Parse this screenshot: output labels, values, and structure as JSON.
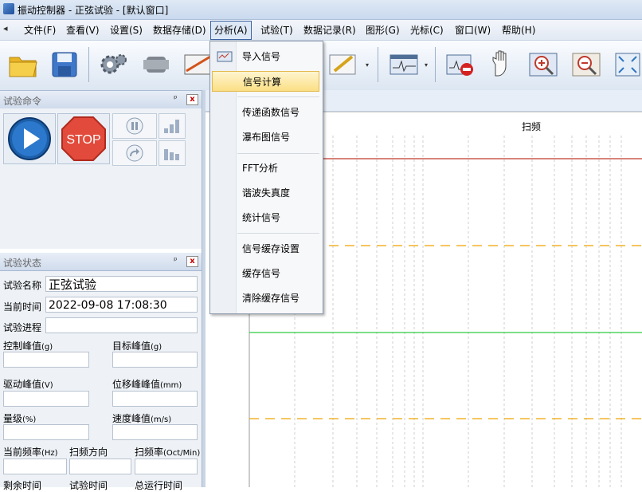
{
  "window": {
    "title": "振动控制器 - 正弦试验 - [默认窗口]"
  },
  "menubar": {
    "items": [
      {
        "label": "文件(F)"
      },
      {
        "label": "查看(V)"
      },
      {
        "label": "设置(S)"
      },
      {
        "label": "数据存储(D)"
      },
      {
        "label": "分析(A)"
      },
      {
        "label": "试验(T)"
      },
      {
        "label": "数据记录(R)"
      },
      {
        "label": "图形(G)"
      },
      {
        "label": "光标(C)"
      },
      {
        "label": "窗口(W)"
      },
      {
        "label": "帮助(H)"
      }
    ],
    "active_index": 4
  },
  "toolbar": {
    "buttons": [
      "open-folder-icon",
      "save-disk-icon",
      "gear-icon",
      "cylinder-icon",
      "chart-edit-icon",
      "pencil-chart-icon",
      "waveform-window-icon",
      "stop-waveform-icon",
      "hand-pan-icon",
      "zoom-in-icon",
      "zoom-out-icon",
      "fit-view-icon"
    ]
  },
  "analysis_menu": {
    "items": [
      {
        "label": "导入信号",
        "icon": "import-signal-icon"
      },
      {
        "label": "信号计算",
        "highlighted": true
      },
      {
        "label": "传递函数信号"
      },
      {
        "label": "瀑布图信号"
      },
      {
        "label": "FFT分析"
      },
      {
        "label": "谐波失真度"
      },
      {
        "label": "统计信号"
      },
      {
        "label": "信号缓存设置"
      },
      {
        "label": "缓存信号"
      },
      {
        "label": "清除缓存信号"
      }
    ]
  },
  "command_panel": {
    "title": "试验命令",
    "pin": "ᵖ",
    "close": "x",
    "play_icon": "play-icon",
    "stop_label": "STOP",
    "pause_icon": "pause-icon",
    "step_icon": "bars-up-icon",
    "redo_icon": "redo-arrow-icon",
    "level_icon": "bars-level-icon"
  },
  "status_panel": {
    "title": "试验状态",
    "test_name_label": "试验名称",
    "test_name_value": "正弦试验",
    "current_time_label": "当前时间",
    "current_time_value": "2022-09-08 17:08:30",
    "progress_label": "试验进程",
    "progress_value": "",
    "control_peak_label": "控制峰值",
    "control_peak_unit": "(g)",
    "target_peak_label": "目标峰值",
    "target_peak_unit": "(g)",
    "drive_peak_label": "驱动峰值",
    "drive_peak_unit": "(V)",
    "disp_peak_label": "位移峰峰值",
    "disp_peak_unit": "(mm)",
    "level_label": "量级",
    "level_unit": "(%)",
    "velocity_peak_label": "速度峰值",
    "velocity_peak_unit": "(m/s)",
    "current_freq_label": "当前频率",
    "current_freq_unit": "(Hz)",
    "sweep_dir_label": "扫频方向",
    "sweep_rate_label": "扫频率",
    "sweep_rate_unit": "(Oct/Min)",
    "remaining_time_label": "剩余时间",
    "test_time_label": "试验时间",
    "total_time_label": "总运行时间"
  },
  "chart": {
    "title": "扫频",
    "colors": {
      "red_line": "#c0392b",
      "green_line": "#2ecc40",
      "orange_dash": "#f0a500",
      "grid": "#cfcfcf"
    }
  }
}
